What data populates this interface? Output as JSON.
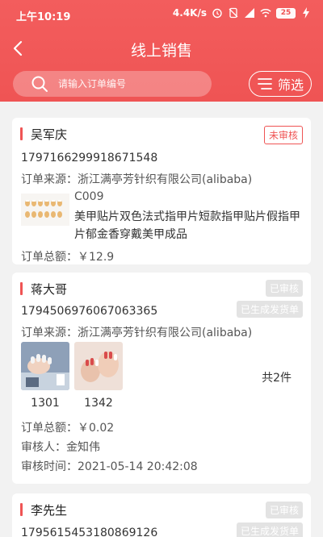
{
  "status_bar": {
    "time": "上午10:19",
    "speed": "4.4K/s",
    "battery": "25"
  },
  "nav": {
    "title": "线上销售"
  },
  "search": {
    "placeholder": "请输入订单编号"
  },
  "filter": {
    "label": "筛选"
  },
  "orders": [
    {
      "customer": "吴军庆",
      "status": "未审核",
      "order_no": "1797166299918671548",
      "source": "订单来源：浙江满亭芳针织有限公司(alibaba)",
      "product_code": "C009",
      "product_desc": "美甲贴片双色法式指甲片短款指甲贴片假指甲片郁金香穿戴美甲成品",
      "total": "订单总额：￥12.9"
    },
    {
      "customer": "蒋大哥",
      "status": "已审核",
      "status2": "已生成发货单",
      "order_no": "1794506976067063365",
      "source": "订单来源：浙江满亭芳针织有限公司(alibaba)",
      "items": [
        {
          "code": "1301"
        },
        {
          "code": "1342"
        }
      ],
      "item_count": "共2件",
      "total": "订单总额：￥0.02",
      "reviewer": "审核人：金知伟",
      "review_time": "审核时间：2021-05-14 20:42:08"
    },
    {
      "customer": "李先生",
      "status": "已审核",
      "status2": "已生成发货单",
      "order_no": "1795615453180869126"
    }
  ],
  "colors": {
    "brand": "#ef5454",
    "page_bg": "#f2f2f2",
    "badge_gray": "#e3e3e3"
  }
}
